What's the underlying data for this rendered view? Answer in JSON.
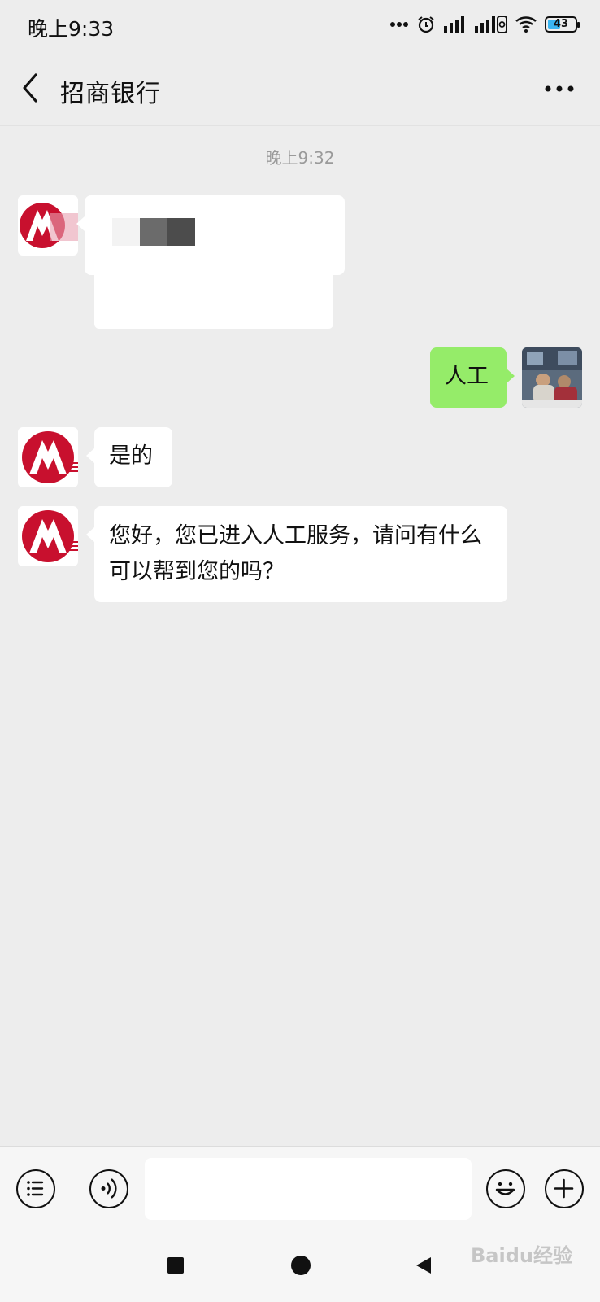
{
  "status_bar": {
    "time": "晚上9:33",
    "battery_level": "43",
    "icons": [
      "more-dots-icon",
      "alarm-icon",
      "signal-icon",
      "signal-icon",
      "wifi-icon",
      "battery-icon"
    ]
  },
  "header": {
    "title": "招商银行"
  },
  "chat": {
    "timestamp": "晚上9:32",
    "messages": [
      {
        "side": "left",
        "text": ""
      },
      {
        "side": "right",
        "text": "人工"
      },
      {
        "side": "left",
        "text": "是的"
      },
      {
        "side": "left",
        "text": "您好，您已进入人工服务，请问有什么可以帮到您的吗？"
      }
    ]
  },
  "input_bar": {
    "input_value": "",
    "left_buttons": [
      "menu-icon",
      "voice-icon"
    ],
    "right_buttons": [
      "emoji-icon",
      "plus-icon"
    ]
  },
  "watermark": "Baidu经验",
  "colors": {
    "background": "#ededed",
    "sent_bubble": "#95ec69",
    "bank_red": "#c8102e"
  }
}
